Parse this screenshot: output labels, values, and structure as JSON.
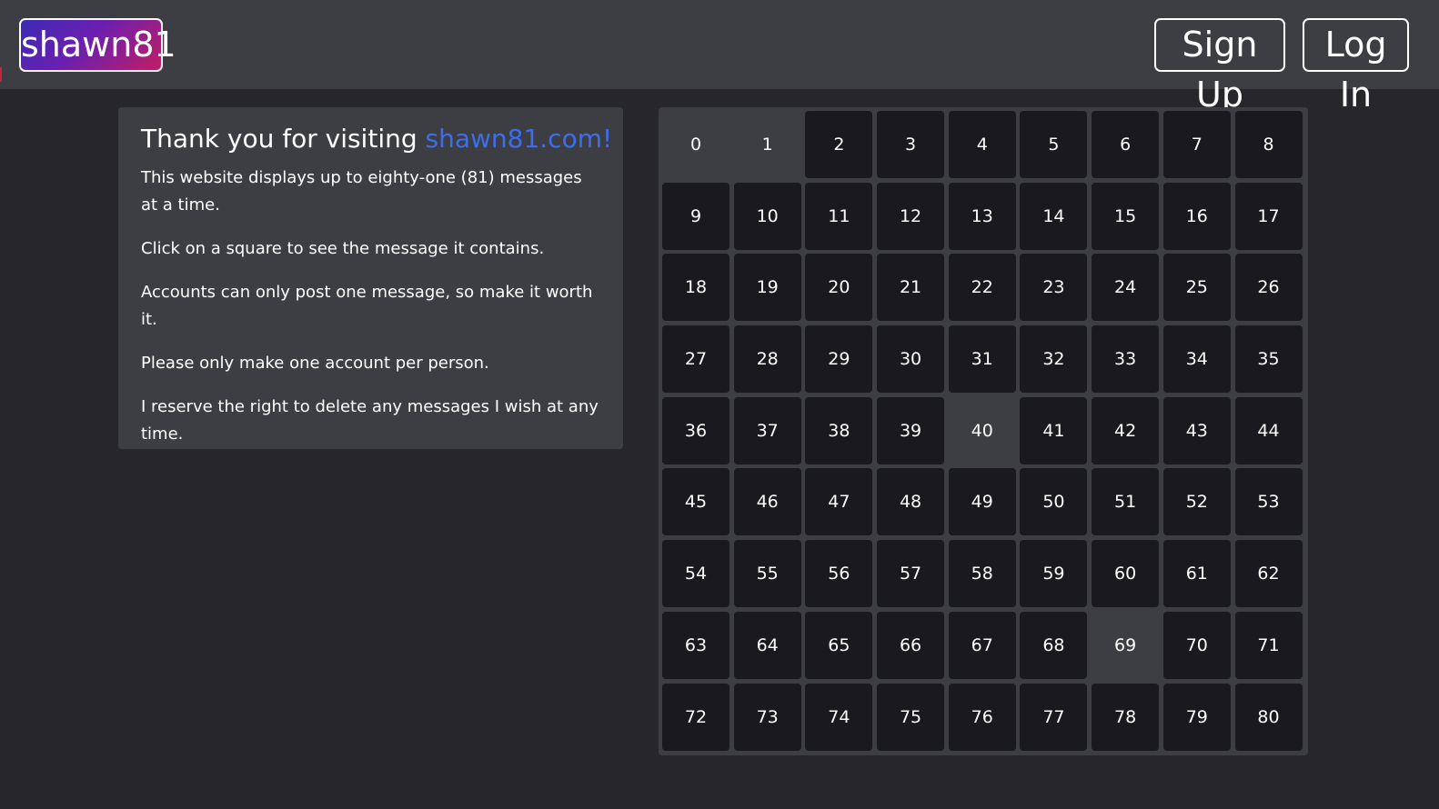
{
  "navbar": {
    "brand": "shawn81",
    "signup_label": "Sign Up",
    "login_label": "Log In"
  },
  "info": {
    "title_prefix": "Thank you for visiting ",
    "title_link": "shawn81.com!",
    "paragraphs": [
      "This website displays up to eighty-one (81) messages at a time.",
      "Click on a square to see the message it contains.",
      "Accounts can only post one message, so make it worth it.",
      "Please only make one account per person.",
      "I reserve the right to delete any messages I wish at any time."
    ]
  },
  "grid": {
    "cells": [
      "0",
      "1",
      "2",
      "3",
      "4",
      "5",
      "6",
      "7",
      "8",
      "9",
      "10",
      "11",
      "12",
      "13",
      "14",
      "15",
      "16",
      "17",
      "18",
      "19",
      "20",
      "21",
      "22",
      "23",
      "24",
      "25",
      "26",
      "27",
      "28",
      "29",
      "30",
      "31",
      "32",
      "33",
      "34",
      "35",
      "36",
      "37",
      "38",
      "39",
      "40",
      "41",
      "42",
      "43",
      "44",
      "45",
      "46",
      "47",
      "48",
      "49",
      "50",
      "51",
      "52",
      "53",
      "54",
      "55",
      "56",
      "57",
      "58",
      "59",
      "60",
      "61",
      "62",
      "63",
      "64",
      "65",
      "66",
      "67",
      "68",
      "69",
      "70",
      "71",
      "72",
      "73",
      "74",
      "75",
      "76",
      "77",
      "78",
      "79",
      "80"
    ],
    "empty_cells": [
      0,
      1,
      40,
      69
    ]
  },
  "colors": {
    "page_bg": "#26262b",
    "panel_bg": "#3d3e44",
    "cell_bg": "#1a1a1e",
    "link": "#3d6ee8"
  }
}
